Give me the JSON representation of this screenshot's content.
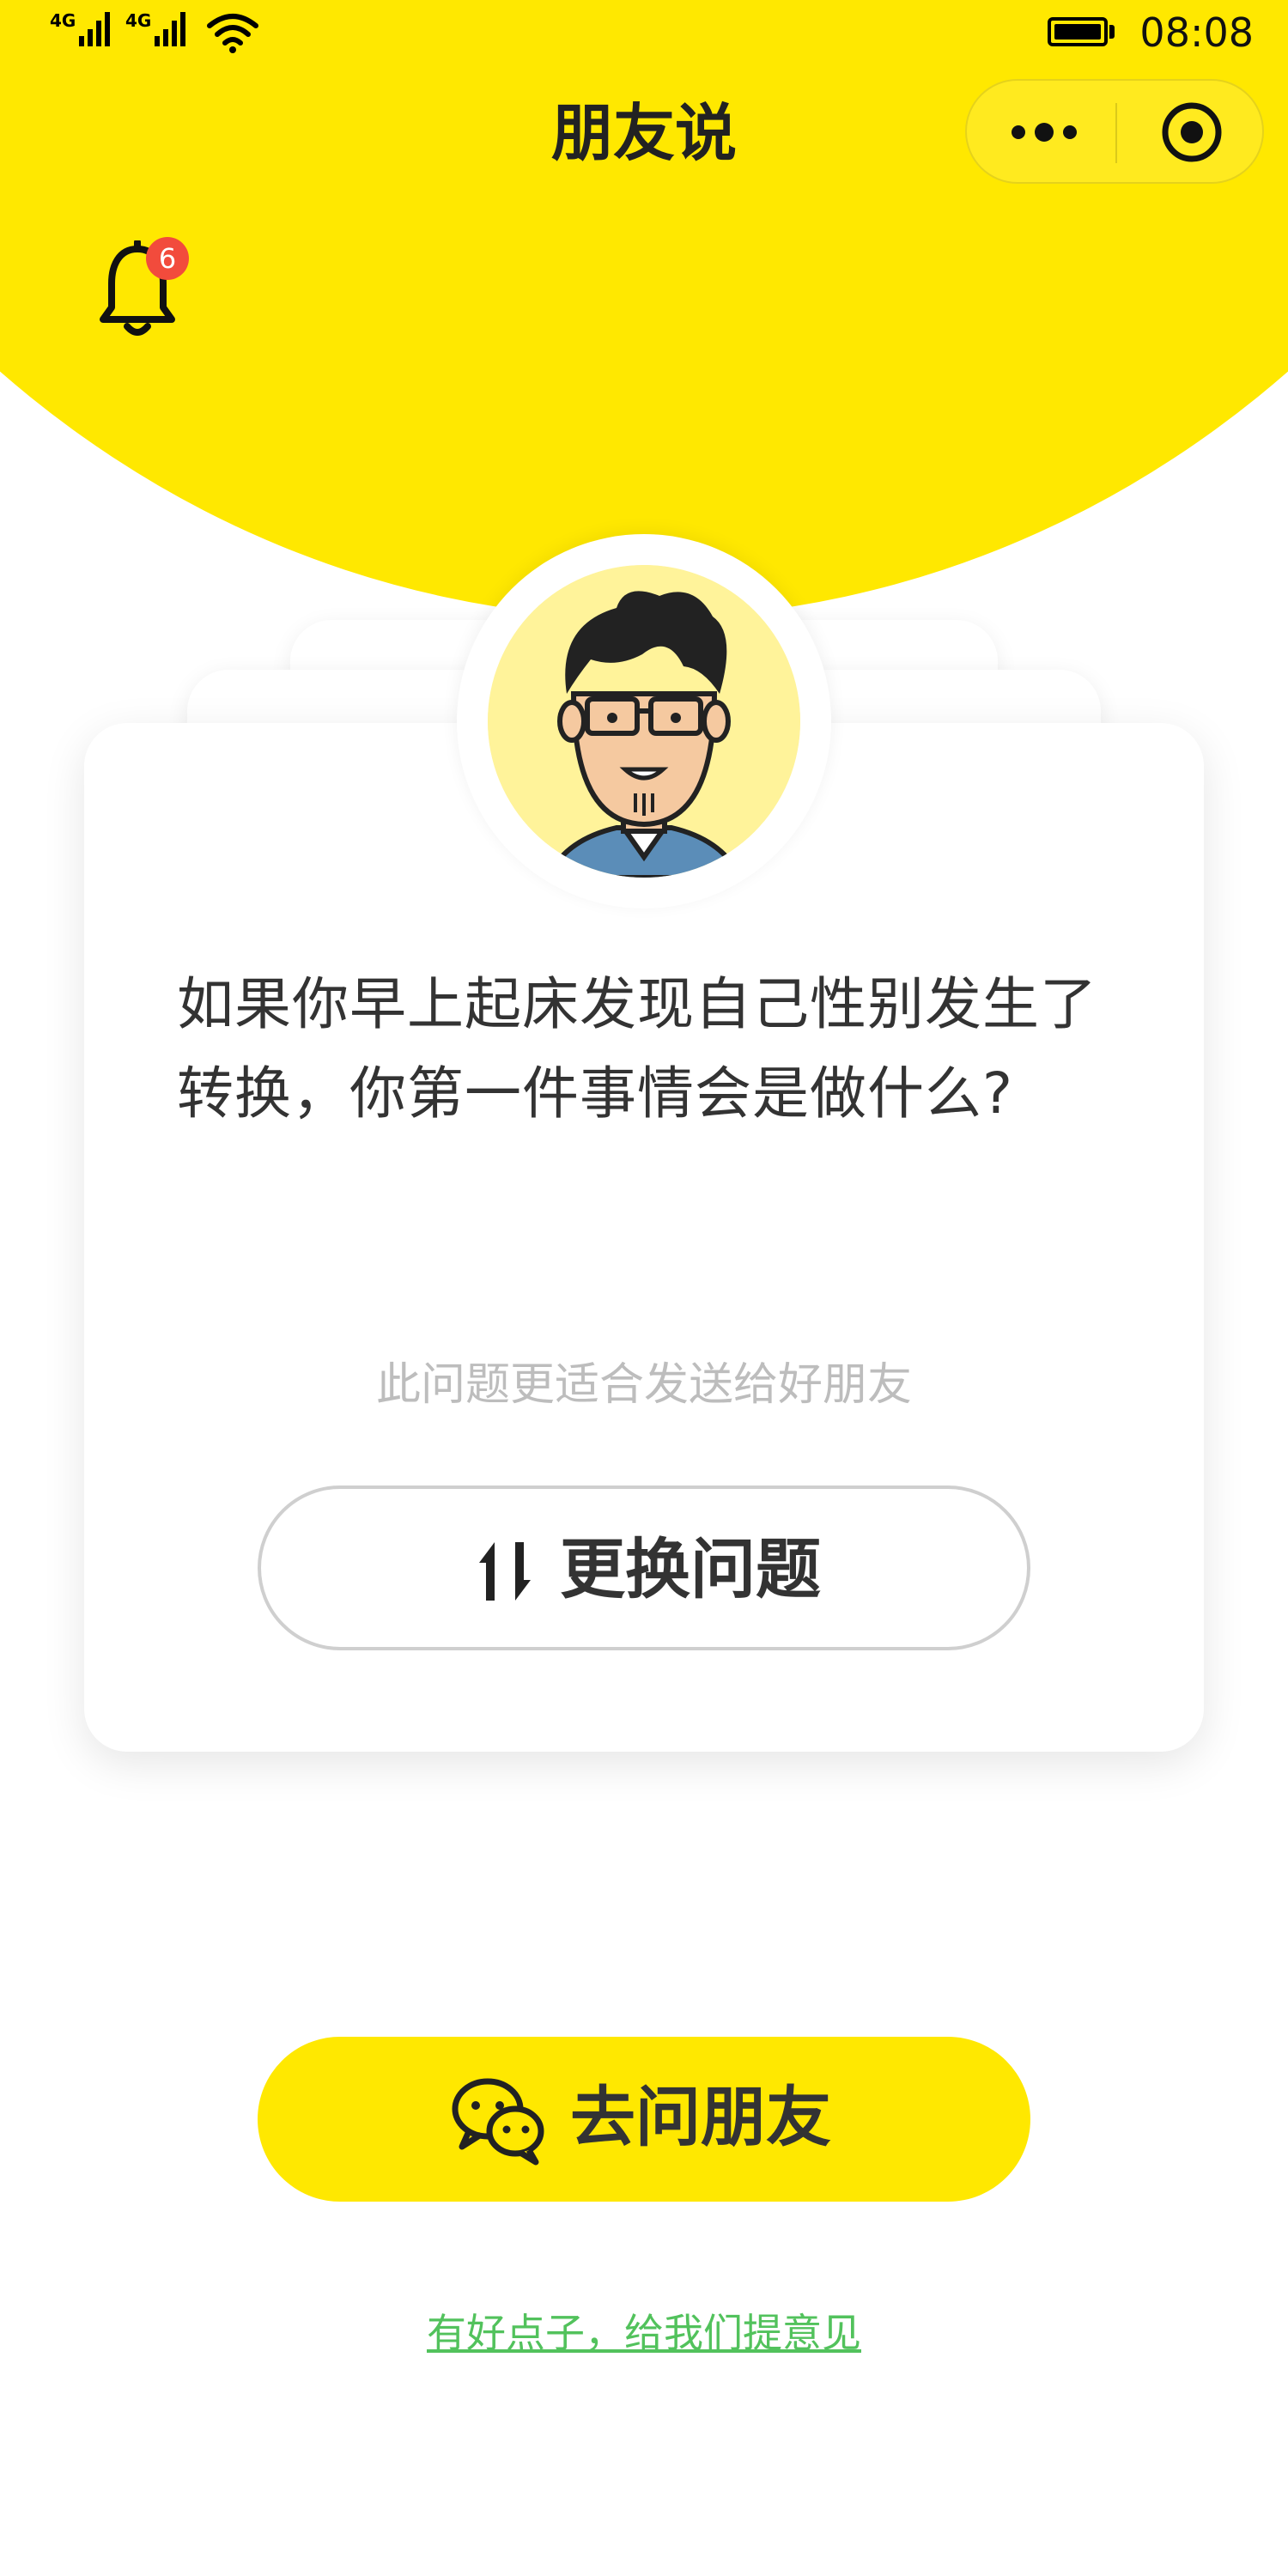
{
  "status_bar": {
    "network_1": "4G",
    "network_2": "4G",
    "time": "08:08",
    "icons": [
      "signal-icon",
      "signal-icon",
      "wifi-icon",
      "battery-icon"
    ]
  },
  "nav": {
    "title": "朋友说",
    "menu_icon": "more-dots-icon",
    "close_icon": "target-circle-icon"
  },
  "notifications": {
    "icon": "bell-icon",
    "badge_count": "6"
  },
  "card": {
    "avatar_icon": "cartoon-man-avatar",
    "question": "如果你早上起床发现自己性别发生了转换，你第一件事情会是做什么?",
    "hint": "此问题更适合发送给好朋友",
    "change_button_label": "更换问题",
    "change_button_icon": "swap-arrows-icon"
  },
  "ask_button": {
    "label": "去问朋友",
    "icon": "wechat-icon"
  },
  "feedback_link": "有好点子，给我们提意见",
  "colors": {
    "accent": "#FFE800",
    "badge": "#F24B3C",
    "link": "#52C25C",
    "hint_text": "#BDBDBD"
  }
}
